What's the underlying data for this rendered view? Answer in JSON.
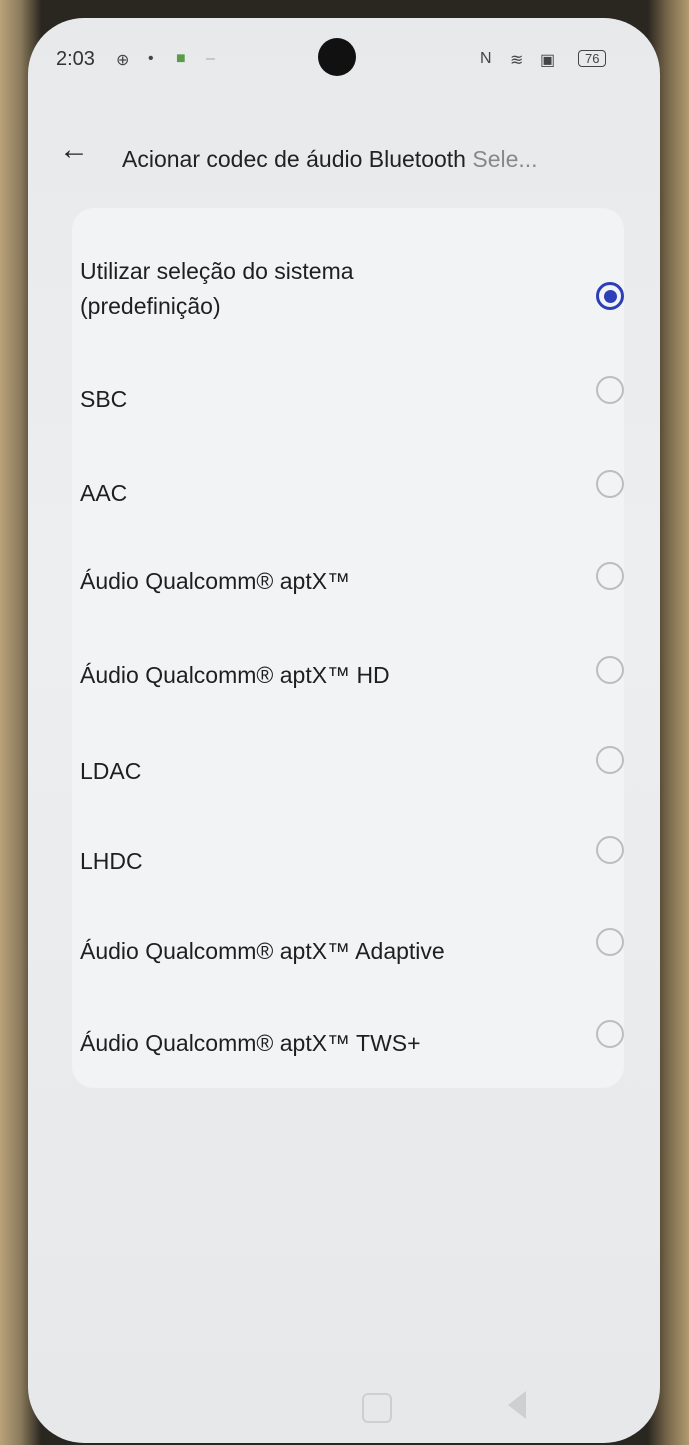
{
  "status_bar": {
    "time": "2:03",
    "battery": "76",
    "icons": [
      "vpn-icon",
      "notification-icon",
      "app-icon",
      "nfc-icon",
      "wifi-icon",
      "sim-icon",
      "battery-icon"
    ]
  },
  "app_bar": {
    "back_icon": "arrow-left-icon",
    "title": "Acionar codec de áudio Bluetooth",
    "title_overflow": "Sele..."
  },
  "options": [
    {
      "label": "Utilizar seleção do sistema (predefinição)",
      "selected": true
    },
    {
      "label": "SBC",
      "selected": false
    },
    {
      "label": "AAC",
      "selected": false
    },
    {
      "label": "Áudio Qualcomm® aptX™",
      "selected": false
    },
    {
      "label": "Áudio Qualcomm® aptX™ HD",
      "selected": false
    },
    {
      "label": "LDAC",
      "selected": false
    },
    {
      "label": "LHDC",
      "selected": false
    },
    {
      "label": "Áudio Qualcomm® aptX™ Adaptive",
      "selected": false
    },
    {
      "label": "Áudio Qualcomm® aptX™ TWS+",
      "selected": false
    }
  ],
  "colors": {
    "accent": "#2c3fb8",
    "background": "#eceef0"
  }
}
